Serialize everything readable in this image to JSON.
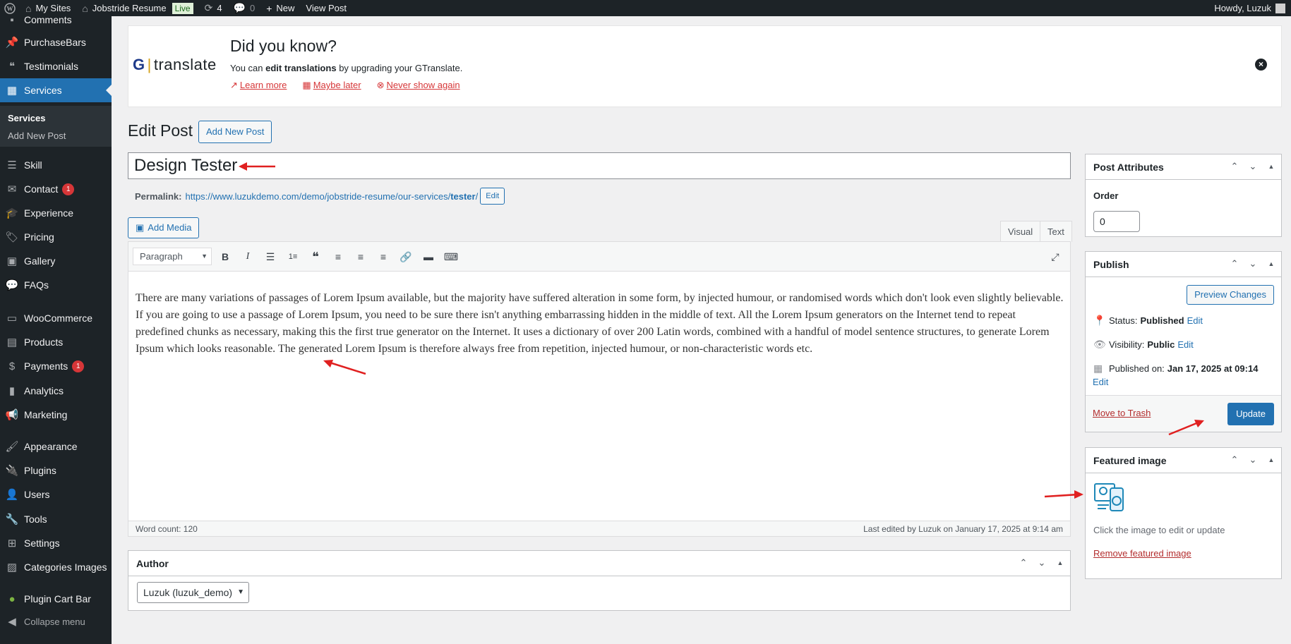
{
  "admin_bar": {
    "my_sites": "My Sites",
    "site_name": "Jobstride Resume",
    "live_badge": "Live",
    "updates_count": "4",
    "comments_count": "0",
    "new_label": "New",
    "view_post": "View Post",
    "howdy": "Howdy, Luzuk"
  },
  "sidebar": {
    "items": [
      {
        "label": "Comments"
      },
      {
        "label": "PurchaseBars"
      },
      {
        "label": "Testimonials"
      },
      {
        "label": "Services"
      },
      {
        "label": "Skill"
      },
      {
        "label": "Contact",
        "badge": "1"
      },
      {
        "label": "Experience"
      },
      {
        "label": "Pricing"
      },
      {
        "label": "Gallery"
      },
      {
        "label": "FAQs"
      },
      {
        "label": "WooCommerce"
      },
      {
        "label": "Products"
      },
      {
        "label": "Payments",
        "badge": "1"
      },
      {
        "label": "Analytics"
      },
      {
        "label": "Marketing"
      },
      {
        "label": "Appearance"
      },
      {
        "label": "Plugins"
      },
      {
        "label": "Users"
      },
      {
        "label": "Tools"
      },
      {
        "label": "Settings"
      },
      {
        "label": "Categories Images"
      },
      {
        "label": "Plugin Cart Bar"
      }
    ],
    "submenu": {
      "services": "Services",
      "add_new_post": "Add New Post"
    },
    "collapse": "Collapse menu"
  },
  "notice": {
    "logo_g": "G",
    "logo_text": "translate",
    "heading": "Did you know?",
    "msg_pre": "You can",
    "msg_bold": "edit translations",
    "msg_post": "by upgrading your GTranslate.",
    "learn_more": "Learn more",
    "maybe_later": "Maybe later",
    "never_show": "Never show again"
  },
  "page": {
    "title": "Edit Post",
    "add_new": "Add New Post",
    "post_title": "Design Tester",
    "permalink_label": "Permalink:",
    "permalink_base": "https://www.luzukdemo.com/demo/jobstride-resume/our-services/",
    "permalink_slug": "tester",
    "permalink_edit": "Edit"
  },
  "editor": {
    "add_media": "Add Media",
    "tab_visual": "Visual",
    "tab_text": "Text",
    "format": "Paragraph",
    "content": "There are many variations of passages of Lorem Ipsum available, but the majority have suffered alteration in some form, by injected humour, or randomised words which don't look even slightly believable. If you are going to use a passage of Lorem Ipsum, you need to be sure there isn't anything embarrassing hidden in the middle of text. All the Lorem Ipsum generators on the Internet tend to repeat predefined chunks as necessary, making this the first true generator on the Internet. It uses a dictionary of over 200 Latin words, combined with a handful of model sentence structures, to generate Lorem Ipsum which looks reasonable. The generated Lorem Ipsum is therefore always free from repetition, injected humour, or non-characteristic words etc.",
    "word_count": "Word count: 120",
    "last_edited": "Last edited by Luzuk on January 17, 2025 at 9:14 am"
  },
  "author": {
    "title": "Author",
    "selected": "Luzuk (luzuk_demo)"
  },
  "post_attributes": {
    "title": "Post Attributes",
    "order_label": "Order",
    "order_value": "0"
  },
  "publish": {
    "title": "Publish",
    "preview": "Preview Changes",
    "status_label": "Status:",
    "status_value": "Published",
    "visibility_label": "Visibility:",
    "visibility_value": "Public",
    "published_label": "Published on:",
    "published_value": "Jan 17, 2025 at 09:14",
    "edit": "Edit",
    "trash": "Move to Trash",
    "update": "Update"
  },
  "featured_image": {
    "title": "Featured image",
    "help": "Click the image to edit or update",
    "remove": "Remove featured image"
  },
  "colors": {
    "accent": "#2271b1",
    "sidebar_bg": "#1d2327",
    "annotation_arrow": "#e02020"
  }
}
